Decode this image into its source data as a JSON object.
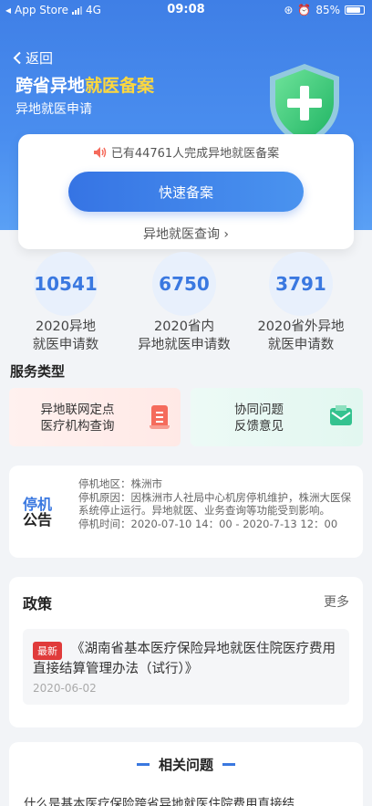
{
  "status_bar": {
    "carrier": "App Store",
    "network": "4G",
    "time": "09:08",
    "battery": "85%",
    "battery_level": 0.85
  },
  "header": {
    "back_label": "返回",
    "title_prefix": "跨省异地",
    "title_highlight": "就医备案",
    "subtitle": "异地就医申请"
  },
  "card": {
    "notice": "已有44761人完成异地就医备案",
    "primary_button": "快速备案",
    "query_link": "异地就医查询"
  },
  "stats": [
    {
      "value": "10541",
      "line1": "2020异地",
      "line2": "就医申请数"
    },
    {
      "value": "6750",
      "line1": "2020省内",
      "line2": "异地就医申请数"
    },
    {
      "value": "3791",
      "line1": "2020省外异地",
      "line2": "就医申请数"
    }
  ],
  "services": {
    "title": "服务类型",
    "items": [
      {
        "line1": "异地联网定点",
        "line2": "医疗机构查询",
        "icon": "hospital-document-icon",
        "color": "#f56b5c"
      },
      {
        "line1": "协同问题",
        "line2": "反馈意见",
        "icon": "mail-icon",
        "color": "#34c28f"
      }
    ]
  },
  "announcement": {
    "label_top": "停机",
    "label_bottom": "公告",
    "area": "停机地区：株洲市",
    "reason": "停机原因：因株洲市人社局中心机房停机维护，株洲大医保系统停止运行。异地就医、业务查询等功能受到影响。",
    "time": "停机时间：2020-07-10 14：00 - 2020-7-13 12：00"
  },
  "policy": {
    "title": "政策",
    "more": "更多",
    "item": {
      "badge": "最新",
      "text": "《湖南省基本医疗保险异地就医住院医疗费用直接结算管理办法（试行）》",
      "date": "2020-06-02"
    }
  },
  "faq": {
    "title": "相关问题",
    "question": "什么是基本医疗保险跨省异地就医住院费用直接结"
  },
  "colors": {
    "primary": "#3a78e0",
    "highlight": "#ffd83d",
    "badge": "#e03b3b"
  }
}
